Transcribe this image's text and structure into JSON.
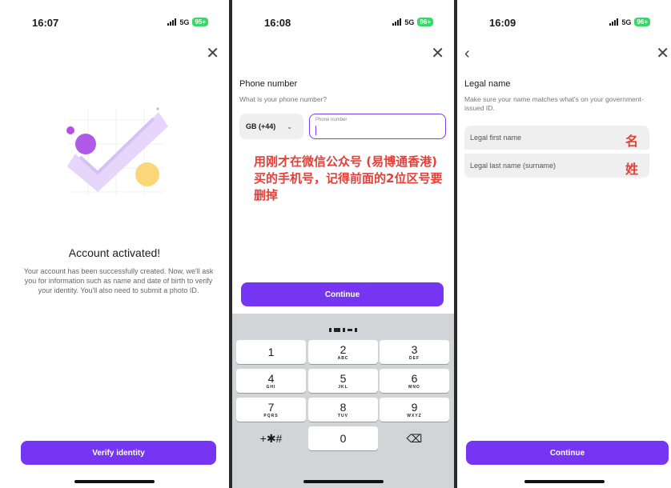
{
  "screen1": {
    "time": "16:07",
    "network": "5G",
    "battery": "95+",
    "title": "Account activated!",
    "description": "Your account has been successfully created. Now, we'll ask you for information such as name and date of birth to verify your identity. You'll also need to submit a photo ID.",
    "button": "Verify identity"
  },
  "screen2": {
    "time": "16:08",
    "network": "5G",
    "battery": "96+",
    "title": "Phone number",
    "subtitle": "What is your phone number?",
    "country_code": "GB (+44)",
    "phone_placeholder": "Phone number",
    "annotation": "用刚才在微信公众号 (易博通香港) 买的手机号，记得前面的2位区号要删掉",
    "button": "Continue",
    "keypad": [
      {
        "n": "1",
        "l": ""
      },
      {
        "n": "2",
        "l": "ABC"
      },
      {
        "n": "3",
        "l": "DEF"
      },
      {
        "n": "4",
        "l": "GHI"
      },
      {
        "n": "5",
        "l": "JKL"
      },
      {
        "n": "6",
        "l": "MNO"
      },
      {
        "n": "7",
        "l": "PQRS"
      },
      {
        "n": "8",
        "l": "TUV"
      },
      {
        "n": "9",
        "l": "WXYZ"
      },
      {
        "n": "+✱#",
        "l": ""
      },
      {
        "n": "0",
        "l": ""
      },
      {
        "n": "⌫",
        "l": ""
      }
    ]
  },
  "screen3": {
    "time": "16:09",
    "network": "5G",
    "battery": "96+",
    "title": "Legal name",
    "subtitle": "Make sure your name matches what's on your government-issued ID.",
    "first_name_label": "Legal first name",
    "first_name_annotation": "名",
    "last_name_label": "Legal last name (surname)",
    "last_name_annotation": "姓",
    "button": "Continue"
  },
  "colors": {
    "accent": "#7535f2",
    "annotation": "#e3403a",
    "battery": "#3ad66a"
  },
  "icons": {
    "close": "close-icon",
    "back": "back-chevron-icon",
    "dropdown": "chevron-down-icon",
    "backspace": "backspace-icon"
  }
}
